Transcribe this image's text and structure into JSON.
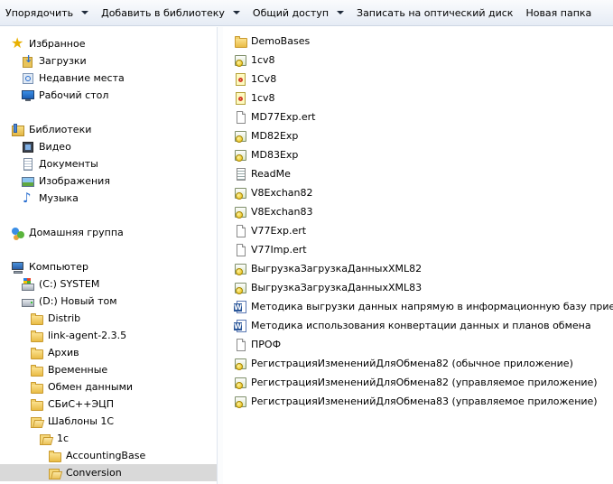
{
  "toolbar": {
    "organize": "Упорядочить",
    "add_to_library": "Добавить в библиотеку",
    "share": "Общий доступ",
    "burn": "Записать на оптический диск",
    "new_folder": "Новая папка"
  },
  "nav": {
    "favorites": "Избранное",
    "downloads": "Загрузки",
    "recent": "Недавние места",
    "desktop": "Рабочий стол",
    "libraries": "Библиотеки",
    "video": "Видео",
    "documents": "Документы",
    "images": "Изображения",
    "music": "Музыка",
    "homegroup": "Домашняя группа",
    "computer": "Компьютер",
    "drive_c": "(C:) SYSTEM",
    "drive_d": "(D:) Новый том",
    "folders": [
      "Distrib",
      "link-agent-2.3.5",
      "Архив",
      "Временные",
      "Обмен данными",
      "СБиС++ЭЦП"
    ],
    "templates": "Шаблоны 1С",
    "f_1c": "1c",
    "accounting": "AccountingBase",
    "conversion": "Conversion"
  },
  "files": [
    {
      "name": "DemoBases",
      "icon": "folder-icon"
    },
    {
      "name": "1cv8",
      "icon": "epf-file-icon"
    },
    {
      "name": "1Cv8",
      "icon": "ert-file-icon"
    },
    {
      "name": "1cv8",
      "icon": "ert-file-icon"
    },
    {
      "name": "MD77Exp.ert",
      "icon": "file-icon"
    },
    {
      "name": "MD82Exp",
      "icon": "epf-file-icon"
    },
    {
      "name": "MD83Exp",
      "icon": "epf-file-icon"
    },
    {
      "name": "ReadMe",
      "icon": "text-file-icon"
    },
    {
      "name": "V8Exchan82",
      "icon": "epf-file-icon"
    },
    {
      "name": "V8Exchan83",
      "icon": "epf-file-icon"
    },
    {
      "name": "V77Exp.ert",
      "icon": "file-icon"
    },
    {
      "name": "V77Imp.ert",
      "icon": "file-icon"
    },
    {
      "name": "ВыгрузкаЗагрузкаДанныхXML82",
      "icon": "epf-file-icon"
    },
    {
      "name": "ВыгрузкаЗагрузкаДанныхXML83",
      "icon": "epf-file-icon"
    },
    {
      "name": "Методика выгрузки данных напрямую в информационную базу приемника",
      "icon": "word-file-icon"
    },
    {
      "name": "Методика использования конвертации данных и планов обмена",
      "icon": "word-file-icon"
    },
    {
      "name": "ПРОФ",
      "icon": "file-icon"
    },
    {
      "name": "РегистрацияИзмененийДляОбмена82 (обычное приложение)",
      "icon": "epf-file-icon"
    },
    {
      "name": "РегистрацияИзмененийДляОбмена82 (управляемое приложение)",
      "icon": "epf-file-icon"
    },
    {
      "name": "РегистрацияИзмененийДляОбмена83 (управляемое приложение)",
      "icon": "epf-file-icon"
    }
  ]
}
